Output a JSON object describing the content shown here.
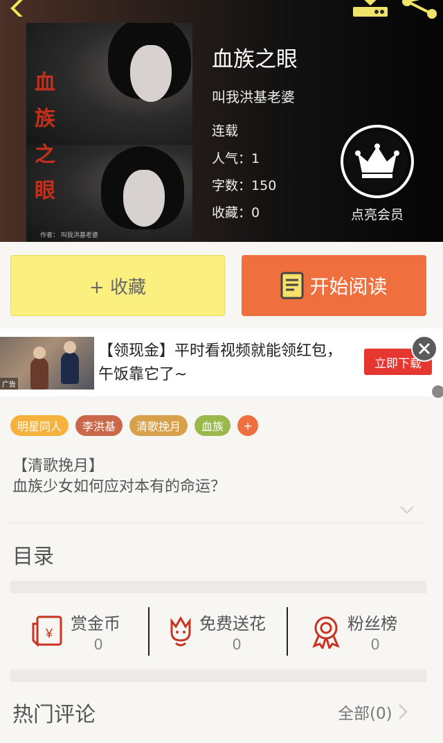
{
  "book": {
    "title": "血族之眼",
    "author": "叫我洪基老婆",
    "status": "连载",
    "stats": [
      {
        "key": "人气：",
        "value": "1"
      },
      {
        "key": "字数：",
        "value": "150"
      },
      {
        "key": "收藏：",
        "value": "0"
      }
    ],
    "cover_title_chars": [
      "血",
      "族",
      "之",
      "眼"
    ],
    "cover_author": "作者： 叫我洪基老婆"
  },
  "vip": {
    "label": "点亮会员"
  },
  "actions": {
    "collect": "+ 收藏",
    "read": "开始阅读"
  },
  "ad": {
    "tag": "广告",
    "text": "【领现金】平时看视频就能领红包，午饭靠它了~",
    "button": "立即下载"
  },
  "tags": [
    {
      "label": "明星同人",
      "color": "#f5b23c"
    },
    {
      "label": "李洪基",
      "color": "#c9684b"
    },
    {
      "label": "清歌挽月",
      "color": "#d8a04a"
    },
    {
      "label": "血族",
      "color": "#9bb84c"
    }
  ],
  "tag_add": "+",
  "intro": {
    "line1": "【清歌挽月】",
    "line2": "血族少女如何应对本有的命运？"
  },
  "toc": "目录",
  "rewards": [
    {
      "label": "赏金币",
      "value": "0",
      "icon": "red-envelope-icon"
    },
    {
      "label": "免费送花",
      "value": "0",
      "icon": "flower-icon"
    },
    {
      "label": "粉丝榜",
      "value": "0",
      "icon": "medal-icon"
    }
  ],
  "comments": {
    "title": "热门评论",
    "all": "全部(0)"
  },
  "colors": {
    "accent_orange": "#ef6f3e",
    "collect_yellow": "#fbf07f",
    "icon_red": "#c8321f",
    "ad_red": "#e5372f"
  }
}
